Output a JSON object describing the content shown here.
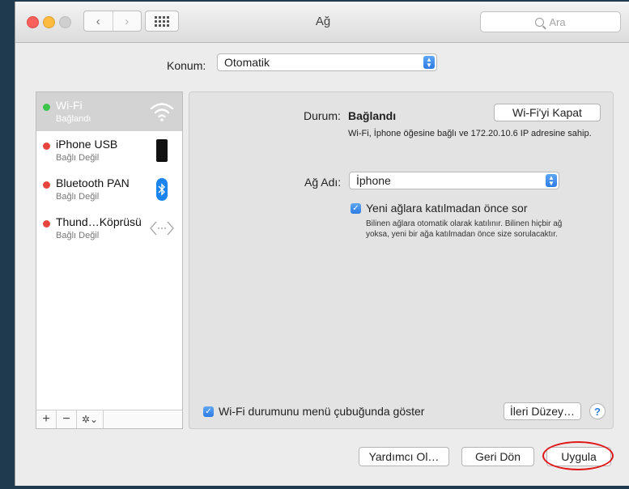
{
  "window": {
    "title": "Ağ",
    "search_placeholder": "Ara",
    "nav_back_glyph": "‹",
    "nav_forward_glyph": "›"
  },
  "location": {
    "label": "Konum:",
    "value": "Otomatik"
  },
  "sidebar": {
    "items": [
      {
        "name": "Wi-Fi",
        "status": "Bağlandı",
        "status_color": "#3cc54b",
        "icon": "wifi-icon"
      },
      {
        "name": "iPhone USB",
        "status": "Bağlı Değil",
        "status_color": "#e5453c",
        "icon": "iphone-icon"
      },
      {
        "name": "Bluetooth PAN",
        "status": "Bağlı Değil",
        "status_color": "#e5453c",
        "icon": "bluetooth-icon"
      },
      {
        "name": "Thund…Köprüsü",
        "status": "Bağlı Değil",
        "status_color": "#e5453c",
        "icon": "thunderbolt-bridge-icon"
      }
    ],
    "tools": {
      "add": "+",
      "remove": "−",
      "gear": "✲⌄"
    }
  },
  "detail": {
    "status_label": "Durum:",
    "status_value": "Bağlandı",
    "wifi_off_button": "Wi-Fi'yi Kapat",
    "status_description": "Wi-Fi, İphone öğesine bağlı ve 172.20.10.6 IP adresine sahip.",
    "network_name_label": "Ağ Adı:",
    "network_name_value": "İphone",
    "ask_join_label": "Yeni ağlara katılmadan önce sor",
    "ask_join_checked": true,
    "ask_join_description": "Bilinen ağlara otomatik olarak katılınır. Bilinen hiçbir ağ yoksa, yeni bir ağa katılmadan önce size sorulacaktır.",
    "show_in_menu_label": "Wi-Fi durumunu menü çubuğunda göster",
    "show_in_menu_checked": true,
    "advanced_button": "İleri Düzey…",
    "help_button": "?"
  },
  "footer": {
    "assist_button": "Yardımcı Ol…",
    "revert_button": "Geri Dön",
    "apply_button": "Uygula"
  },
  "colors": {
    "accent": "#2d7ce3",
    "highlight_ellipse": "#e01818",
    "background": "#1f3a4e"
  }
}
